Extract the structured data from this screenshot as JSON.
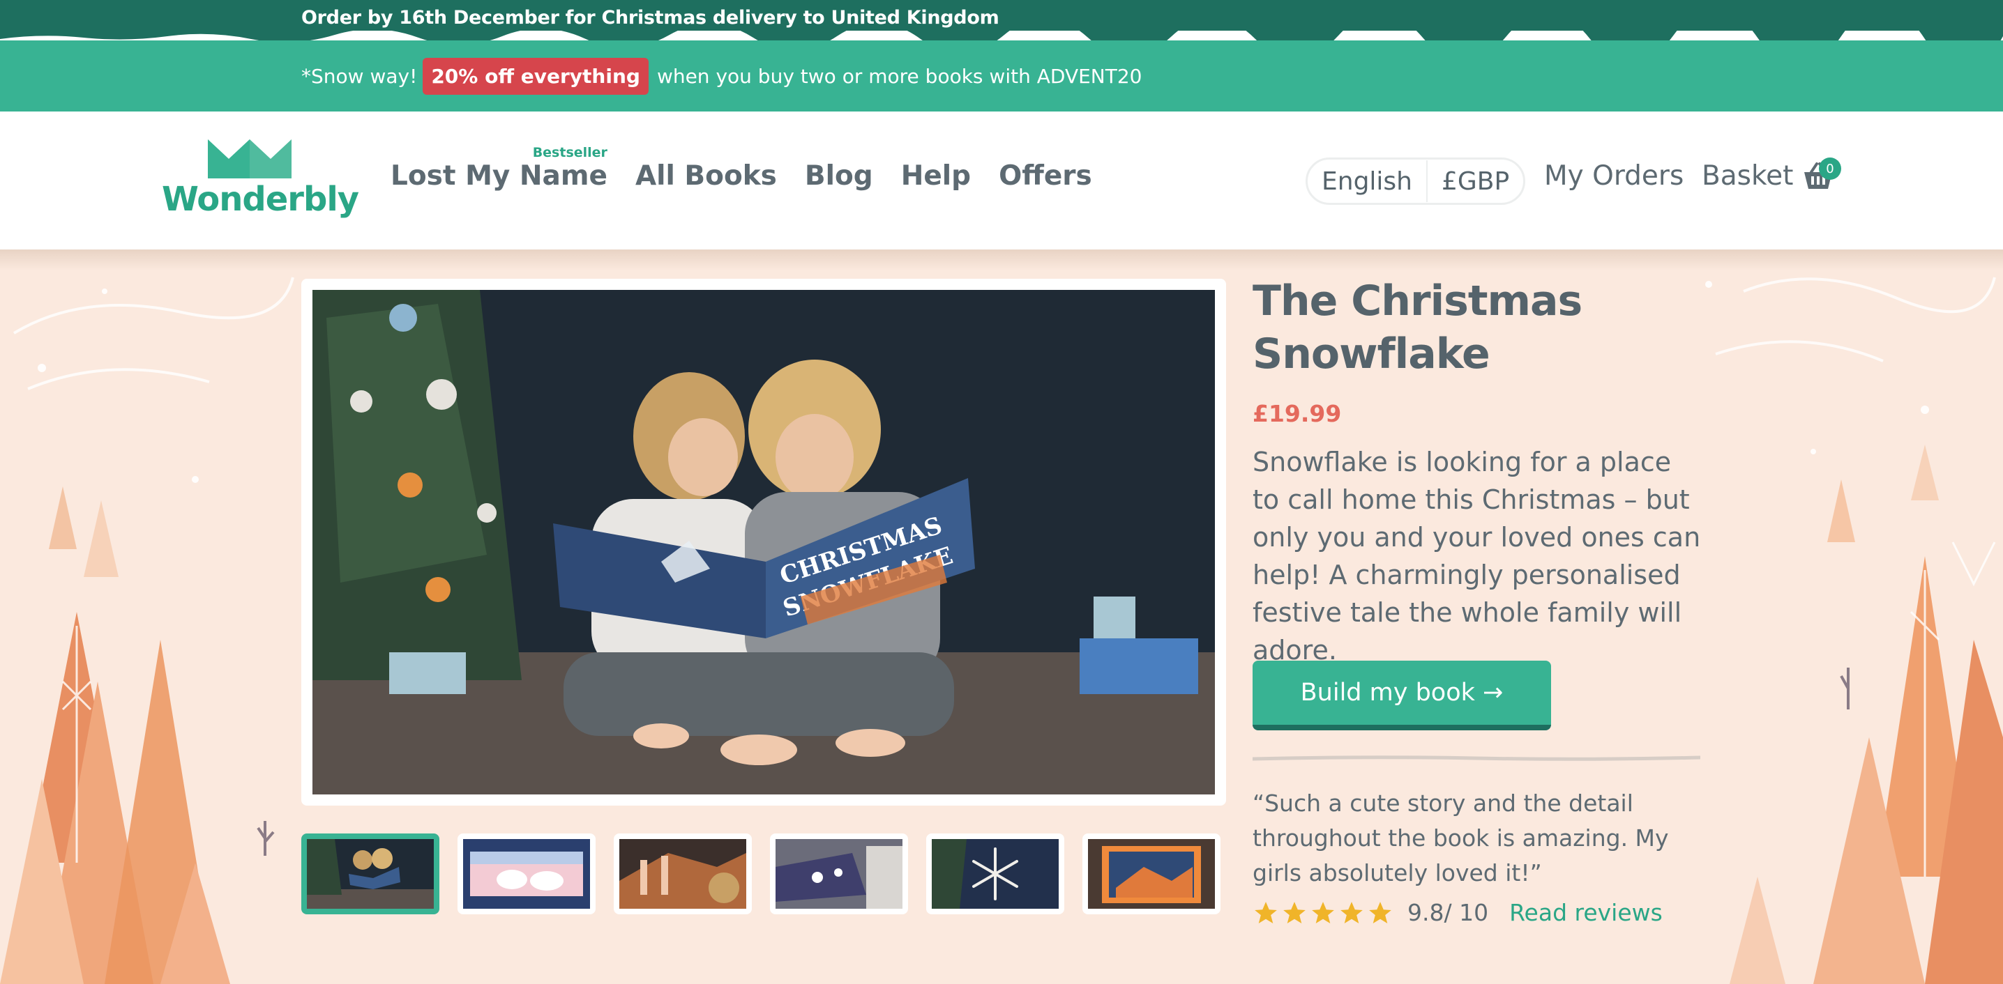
{
  "topbar": {
    "text": "Order by 16th December for Christmas delivery to United Kingdom"
  },
  "promo": {
    "prefix": "*Snow way!",
    "badge": "20% off everything",
    "suffix": "when you buy two or more books with ADVENT20"
  },
  "header": {
    "logo_text": "Wonderbly",
    "nav": [
      {
        "label": "Lost My Name",
        "badge": "Bestseller"
      },
      {
        "label": "All Books"
      },
      {
        "label": "Blog"
      },
      {
        "label": "Help"
      },
      {
        "label": "Offers"
      }
    ],
    "language": "English",
    "currency": "£GBP",
    "my_orders": "My Orders",
    "basket": "Basket",
    "basket_count": "0",
    "icons": {
      "basket": "basket-icon",
      "logo": "crown-logo-icon"
    }
  },
  "product": {
    "title": "The Christmas Snowflake",
    "price": "£19.99",
    "description": "Snowflake is looking for a place to call home this Christmas – but only you and your loved ones can help! A charmingly personalised festive tale the whole family will adore.",
    "cta": "Build my book →",
    "quote": "“Such a cute story and the detail throughout the book is amazing. My girls absolutely loved it!”",
    "rating_value": 9.8,
    "rating_text": "9.8/ 10",
    "stars_filled": 5,
    "stars_total": 5,
    "reviews_link": "Read reviews",
    "thumbnails": 6,
    "active_thumbnail": 1,
    "book_cover_title": "THE CHRISTMAS SNOWFLAKE"
  },
  "colors": {
    "topbar": "#1e6f5f",
    "promo": "#38b393",
    "badge": "#d6454c",
    "accent": "#2aa686",
    "price": "#e4695c",
    "background": "#fbe9de",
    "text": "#55636b",
    "star": "#f0b429"
  }
}
